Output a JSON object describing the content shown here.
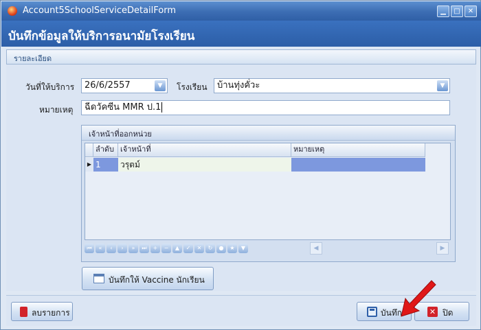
{
  "window": {
    "title": "Account5SchoolServiceDetailForm",
    "controls": [
      "minimize-icon",
      "maximize-icon",
      "close-icon"
    ]
  },
  "header": {
    "title": "บันทึกข้อมูลให้บริการอนามัยโรงเรียน"
  },
  "section": {
    "title": "รายละเอียด"
  },
  "form": {
    "service_date_label": "วันที่ให้บริการ",
    "service_date_value": "26/6/2557",
    "school_label": "โรงเรียน",
    "school_value": "บ้านทุ่งคั่วะ",
    "remark_label": "หมายเหตุ",
    "remark_value": "ฉีดวัคซีน MMR ป.1"
  },
  "staff_group": {
    "title": "เจ้าหน้าที่ออกหน่วย",
    "columns": [
      "ลำดับ",
      "เจ้าหน้าที่",
      "หมายเหตุ"
    ],
    "rows": [
      {
        "no": "1",
        "staff": "วรุตม์",
        "remark": ""
      }
    ]
  },
  "vaccine_button": {
    "label": "บันทึกให้ Vaccine นักเรียน",
    "icon": "calendar-icon"
  },
  "footer": {
    "delete_label": "ลบรายการ",
    "save_label": "บันทึก",
    "close_label": "ปิด"
  },
  "colors": {
    "accent": "#2f5fa6",
    "selected_row": "#7d98de",
    "close_red": "#d2232a"
  }
}
